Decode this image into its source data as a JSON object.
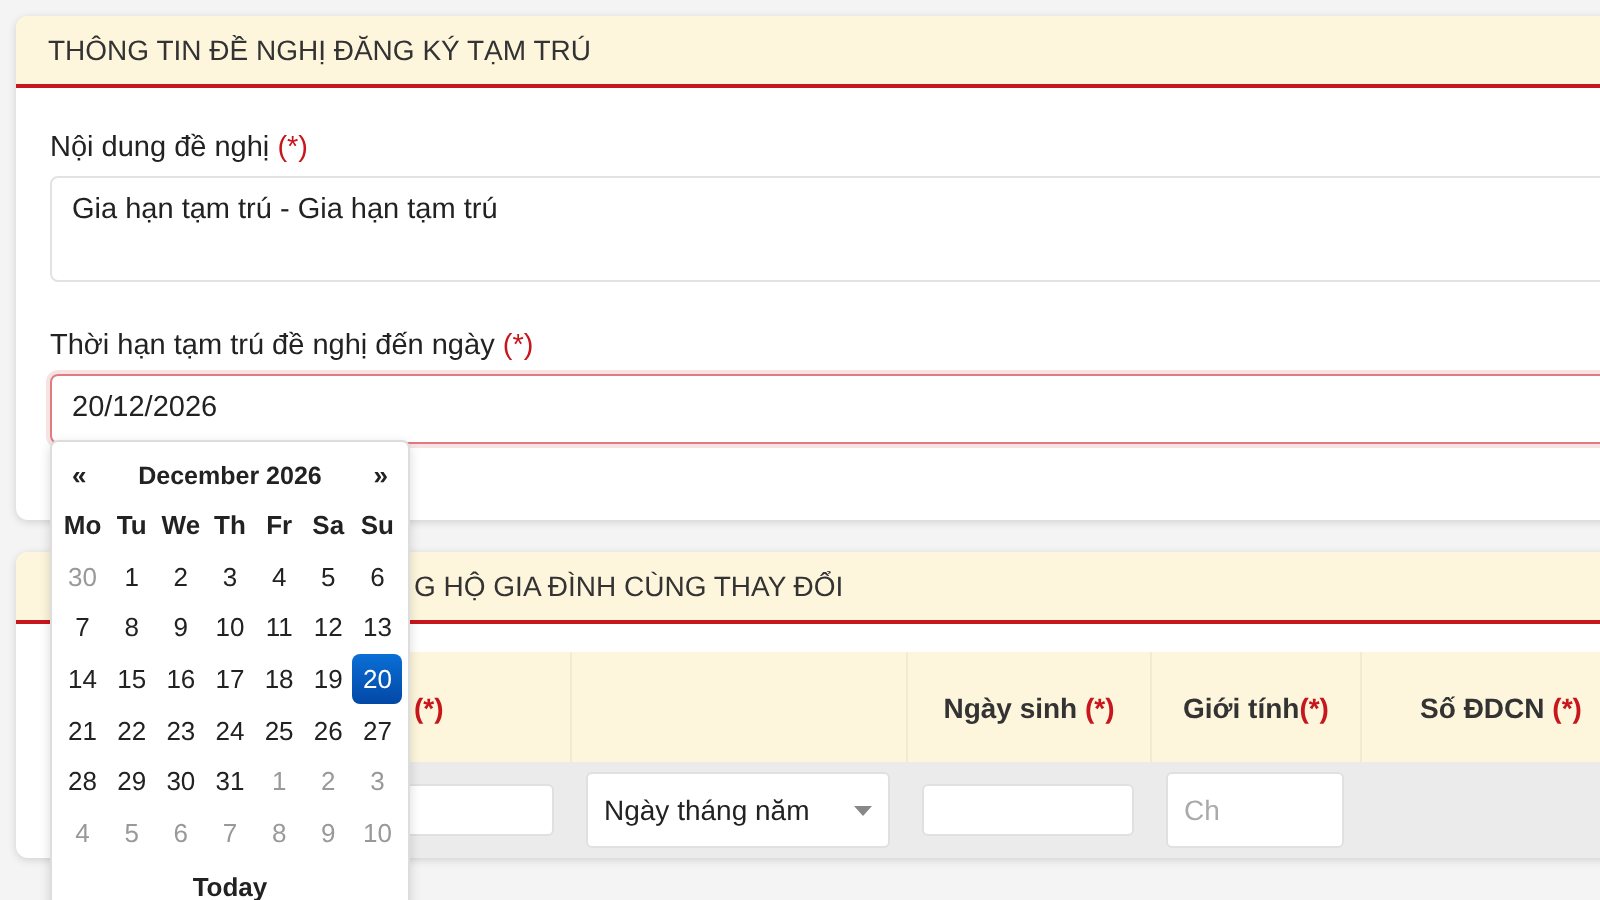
{
  "section1": {
    "title": "THÔNG TIN ĐỀ NGHỊ ĐĂNG KÝ TẠM TRÚ",
    "fields": [
      {
        "kind": "textarea",
        "label": "Nội dung đề nghị",
        "required": "(*)",
        "value": "Gia hạn tạm trú - Gia hạn tạm trú",
        "focused": false
      },
      {
        "kind": "date",
        "label": "Thời hạn tạm trú đề nghị đến ngày",
        "required": "(*)",
        "value": "20/12/2026",
        "focused": true
      }
    ]
  },
  "calendar": {
    "prev": "«",
    "title": "December 2026",
    "next": "»",
    "weekdays": [
      "Mo",
      "Tu",
      "We",
      "Th",
      "Fr",
      "Sa",
      "Su"
    ],
    "weeks": [
      [
        {
          "day": "30",
          "muted": true,
          "selected": false
        },
        {
          "day": "1",
          "muted": false,
          "selected": false
        },
        {
          "day": "2",
          "muted": false,
          "selected": false
        },
        {
          "day": "3",
          "muted": false,
          "selected": false
        },
        {
          "day": "4",
          "muted": false,
          "selected": false
        },
        {
          "day": "5",
          "muted": false,
          "selected": false
        },
        {
          "day": "6",
          "muted": false,
          "selected": false
        }
      ],
      [
        {
          "day": "7",
          "muted": false,
          "selected": false
        },
        {
          "day": "8",
          "muted": false,
          "selected": false
        },
        {
          "day": "9",
          "muted": false,
          "selected": false
        },
        {
          "day": "10",
          "muted": false,
          "selected": false
        },
        {
          "day": "11",
          "muted": false,
          "selected": false
        },
        {
          "day": "12",
          "muted": false,
          "selected": false
        },
        {
          "day": "13",
          "muted": false,
          "selected": false
        }
      ],
      [
        {
          "day": "14",
          "muted": false,
          "selected": false
        },
        {
          "day": "15",
          "muted": false,
          "selected": false
        },
        {
          "day": "16",
          "muted": false,
          "selected": false
        },
        {
          "day": "17",
          "muted": false,
          "selected": false
        },
        {
          "day": "18",
          "muted": false,
          "selected": false
        },
        {
          "day": "19",
          "muted": false,
          "selected": false
        },
        {
          "day": "20",
          "muted": false,
          "selected": true
        }
      ],
      [
        {
          "day": "21",
          "muted": false,
          "selected": false
        },
        {
          "day": "22",
          "muted": false,
          "selected": false
        },
        {
          "day": "23",
          "muted": false,
          "selected": false
        },
        {
          "day": "24",
          "muted": false,
          "selected": false
        },
        {
          "day": "25",
          "muted": false,
          "selected": false
        },
        {
          "day": "26",
          "muted": false,
          "selected": false
        },
        {
          "day": "27",
          "muted": false,
          "selected": false
        }
      ],
      [
        {
          "day": "28",
          "muted": false,
          "selected": false
        },
        {
          "day": "29",
          "muted": false,
          "selected": false
        },
        {
          "day": "30",
          "muted": false,
          "selected": false
        },
        {
          "day": "31",
          "muted": false,
          "selected": false
        },
        {
          "day": "1",
          "muted": true,
          "selected": false
        },
        {
          "day": "2",
          "muted": true,
          "selected": false
        },
        {
          "day": "3",
          "muted": true,
          "selected": false
        }
      ],
      [
        {
          "day": "4",
          "muted": true,
          "selected": false
        },
        {
          "day": "5",
          "muted": true,
          "selected": false
        },
        {
          "day": "6",
          "muted": true,
          "selected": false
        },
        {
          "day": "7",
          "muted": true,
          "selected": false
        },
        {
          "day": "8",
          "muted": true,
          "selected": false
        },
        {
          "day": "9",
          "muted": true,
          "selected": false
        },
        {
          "day": "10",
          "muted": true,
          "selected": false
        }
      ]
    ],
    "today": "Today"
  },
  "section2": {
    "title": "G HỘ GIA ĐÌNH CÙNG THAY ĐỔI",
    "columns": [
      {
        "required": "(*)"
      },
      {},
      {
        "label": "Ngày sinh",
        "required": "(*)",
        "spaced": true
      },
      {
        "label": "Giới tính",
        "required": "(*)",
        "spaced": false
      },
      {
        "label": "Số ĐDCN",
        "required": "(*)",
        "spaced": true
      }
    ],
    "row": [
      {
        "kind": "input"
      },
      {
        "kind": "select",
        "value": "Ngày tháng năm"
      },
      {
        "kind": "input"
      },
      {
        "kind": "input",
        "placeholder": "Ch"
      }
    ]
  }
}
